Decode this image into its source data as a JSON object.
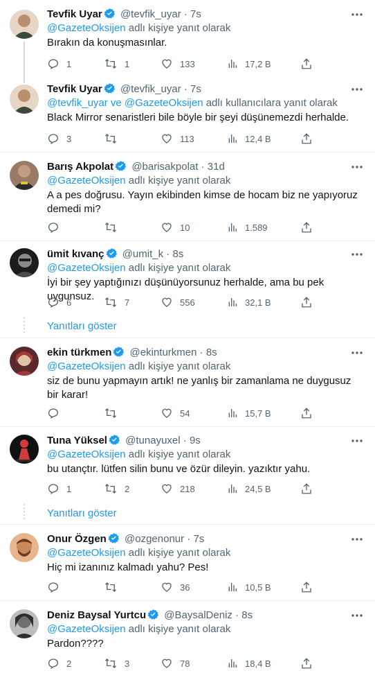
{
  "tweets": [
    {
      "name": "Tevfik Uyar",
      "handle": "@tevfik_uyar",
      "time": "7s",
      "reply_prefix": "",
      "reply_mentions": "@GazeteOksijen",
      "reply_suffix": " adlı kişiye yanıt olarak",
      "text": "Bırakın da konuşmasınlar.",
      "replies": "1",
      "retweets": "1",
      "likes": "133",
      "views": "17,2 B",
      "avatar_colors": [
        "#b98f6e",
        "#3b4a3a",
        "#e7d6c5"
      ]
    },
    {
      "name": "Tevfik Uyar",
      "handle": "@tevfik_uyar",
      "time": "7s",
      "reply_prefix": "",
      "reply_mentions": "@tevfik_uyar ve @GazeteOksijen",
      "reply_suffix": " adlı kullanıcılara yanıt olarak",
      "text": "Black Mirror senaristleri bile böyle bir şeyi düşünemezdi herhalde.",
      "replies": "3",
      "retweets": "",
      "likes": "113",
      "views": "12,4 B",
      "avatar_colors": [
        "#b98f6e",
        "#3b4a3a",
        "#e7d6c5"
      ]
    },
    {
      "name": "Barış Akpolat",
      "handle": "@barisakpolat",
      "time": "31d",
      "reply_prefix": "",
      "reply_mentions": "@GazeteOksijen",
      "reply_suffix": " adlı kişiye yanıt olarak",
      "text": "A a  pes doğrusu. Yayın ekibinden kimse de hocam biz ne yapıyoruz demedi mi?",
      "replies": "",
      "retweets": "",
      "likes": "10",
      "views": "1.589",
      "avatar_colors": [
        "#c29d86",
        "#2a2a2a",
        "#9a7b66"
      ]
    },
    {
      "name": "ümit kıvanç",
      "handle": "@umit_k",
      "time": "8s",
      "reply_prefix": "",
      "reply_mentions": "@GazeteOksijen",
      "reply_suffix": " adlı kişiye yanıt olarak",
      "text": "İyi bir şey yaptığınızı düşünüyorsunuz herhalde, ama bu pek uygunsuz.",
      "replies": "6",
      "retweets": "7",
      "likes": "556",
      "views": "32,1 B",
      "avatar_colors": [
        "#1c1c1c",
        "#8a8a8a",
        "#4a4a4a"
      ],
      "show_replies": "Yanıtları göster"
    },
    {
      "name": "ekin türkmen",
      "handle": "@ekinturkmen",
      "time": "8s",
      "reply_prefix": "",
      "reply_mentions": "@GazeteOksijen",
      "reply_suffix": " adlı kişiye yanıt olarak",
      "text": "siz de bunu yapmayın artık! ne yanlış bir zamanlama ne duygusuz bir karar!",
      "replies": "",
      "retweets": "",
      "likes": "54",
      "views": "15,7 B",
      "avatar_colors": [
        "#a23a3a",
        "#e1c3a8",
        "#5a2a2a"
      ]
    },
    {
      "name": "Tuna Yüksel",
      "handle": "@tunayuxel",
      "time": "9s",
      "reply_prefix": "",
      "reply_mentions": "@GazeteOksijen",
      "reply_suffix": " adlı kişiye yanıt olarak",
      "text": "bu utançtır. lütfen silin bunu ve özür dileyin. yazıktır yahu.",
      "replies": "1",
      "retweets": "2",
      "likes": "218",
      "views": "24,5 B",
      "avatar_colors": [
        "#111111",
        "#d23b3b",
        "#2b2b2b"
      ],
      "show_replies": "Yanıtları göster"
    },
    {
      "name": "Onur Özgen",
      "handle": "@ozgenonur",
      "time": "7s",
      "reply_prefix": "",
      "reply_mentions": "@GazeteOksijen",
      "reply_suffix": " adlı kişiye yanıt olarak",
      "text": "Hiç mi izanınız kalmadı yahu? Pes!",
      "replies": "",
      "retweets": "",
      "likes": "36",
      "views": "10,5 B",
      "avatar_colors": [
        "#c98a5a",
        "#6b3a1f",
        "#e8b48a"
      ]
    },
    {
      "name": "Deniz Baysal Yurtcu",
      "handle": "@BaysalDeniz",
      "time": "8s",
      "reply_prefix": "",
      "reply_mentions": "@GazeteOksijen",
      "reply_suffix": " adlı kişiye yanıt olarak",
      "text": "Pardon????",
      "replies": "2",
      "retweets": "3",
      "likes": "78",
      "views": "18,4 B",
      "avatar_colors": [
        "#6e6e6e",
        "#2e2e2e",
        "#bdbdbd"
      ]
    }
  ],
  "colors": {
    "accent": "#1d9bf0",
    "muted": "#536471",
    "text": "#0f1419",
    "divider": "#eff3f4",
    "thread": "#cfd9de"
  },
  "icons": {
    "reply": "reply-icon",
    "retweet": "retweet-icon",
    "like": "heart-icon",
    "views": "views-icon",
    "share": "share-icon",
    "more": "more-icon",
    "verified": "verified-badge-icon"
  }
}
